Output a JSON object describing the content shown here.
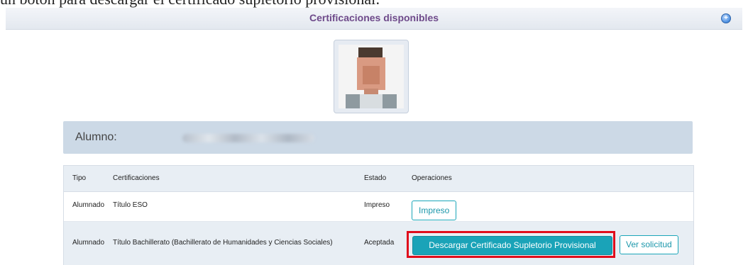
{
  "caption": "un botón para descargar el certificado supletorio provisional:",
  "header": {
    "title": "Certificaciones disponibles",
    "add_icon": "plus-circle-icon",
    "title_color": "#6e4a8a"
  },
  "student": {
    "label": "Alumno:"
  },
  "table": {
    "columns": [
      "Tipo",
      "Certificaciones",
      "Estado",
      "Operaciones"
    ],
    "rows": [
      {
        "tipo": "Alumnado",
        "certificacion": "Título ESO",
        "estado": "Impreso",
        "operations": [
          "Impreso"
        ]
      },
      {
        "tipo": "Alumnado",
        "certificacion": "Título Bachillerato (Bachillerato de Humanidades y Ciencias Sociales)",
        "estado": "Aceptada",
        "operations": [
          "Descargar Certificado Supletorio Provisional",
          "Ver solicitud"
        ]
      }
    ]
  },
  "colors": {
    "accent": "#1aa3b8",
    "highlight": "#e00d1c",
    "bar_bg": "#ccd9e6"
  }
}
